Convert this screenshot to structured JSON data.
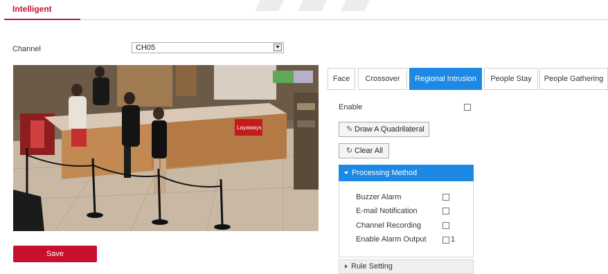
{
  "header": {
    "tab_label": "Intelligent"
  },
  "channel": {
    "label": "Channel",
    "value": "CH05"
  },
  "save_label": "Save",
  "tabs": [
    {
      "label": "Face",
      "active": false
    },
    {
      "label": "Crossover",
      "active": false
    },
    {
      "label": "Regional Intrusion",
      "active": true
    },
    {
      "label": "People Stay",
      "active": false
    },
    {
      "label": "People Gathering",
      "active": false
    }
  ],
  "settings": {
    "enable_label": "Enable",
    "draw_label": "Draw A Quadrilateral",
    "clear_label": "Clear All",
    "processing_label": "Processing Method",
    "options": [
      {
        "label": "Buzzer Alarm"
      },
      {
        "label": "E-mail Notification"
      },
      {
        "label": "Channel Recording"
      },
      {
        "label": "Enable Alarm Output",
        "suffix": "1"
      }
    ],
    "rule_label": "Rule Setting"
  },
  "video_overlay_text": "Layaways",
  "colors": {
    "brand_red": "#c8102e",
    "active_blue": "#1e88e5"
  },
  "icons": {
    "draw": "pencil-icon",
    "clear": "refresh-icon"
  }
}
